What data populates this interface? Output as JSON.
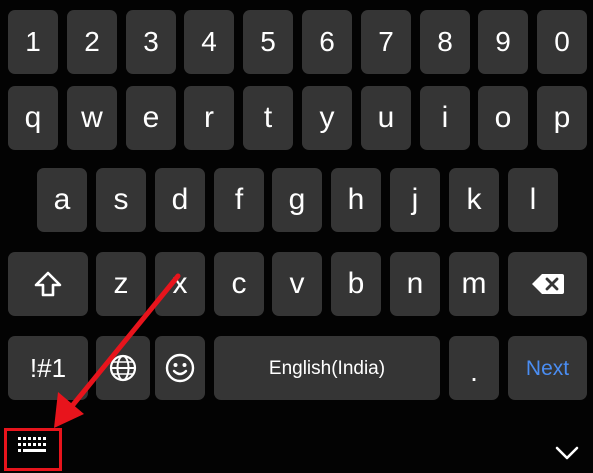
{
  "keyboard": {
    "number_row": [
      "1",
      "2",
      "3",
      "4",
      "5",
      "6",
      "7",
      "8",
      "9",
      "0"
    ],
    "row_q": [
      "q",
      "w",
      "e",
      "r",
      "t",
      "y",
      "u",
      "i",
      "o",
      "p"
    ],
    "row_a": [
      "a",
      "s",
      "d",
      "f",
      "g",
      "h",
      "j",
      "k",
      "l"
    ],
    "row_z": [
      "z",
      "x",
      "c",
      "v",
      "b",
      "n",
      "m"
    ],
    "symbols_label": "!#1",
    "space_label": "English(India)",
    "period_label": ".",
    "action_label": "Next"
  },
  "icons": {
    "shift": "shift-icon",
    "backspace": "backspace-icon",
    "globe": "globe-icon",
    "emoji": "emoji-icon",
    "keyboard": "keyboard-icon",
    "chevron": "chevron-down-icon"
  },
  "colors": {
    "background": "#030303",
    "key": "#353535",
    "key_text": "#ffffff",
    "action_text": "#4a8df2",
    "annotation": "#e8141c"
  }
}
